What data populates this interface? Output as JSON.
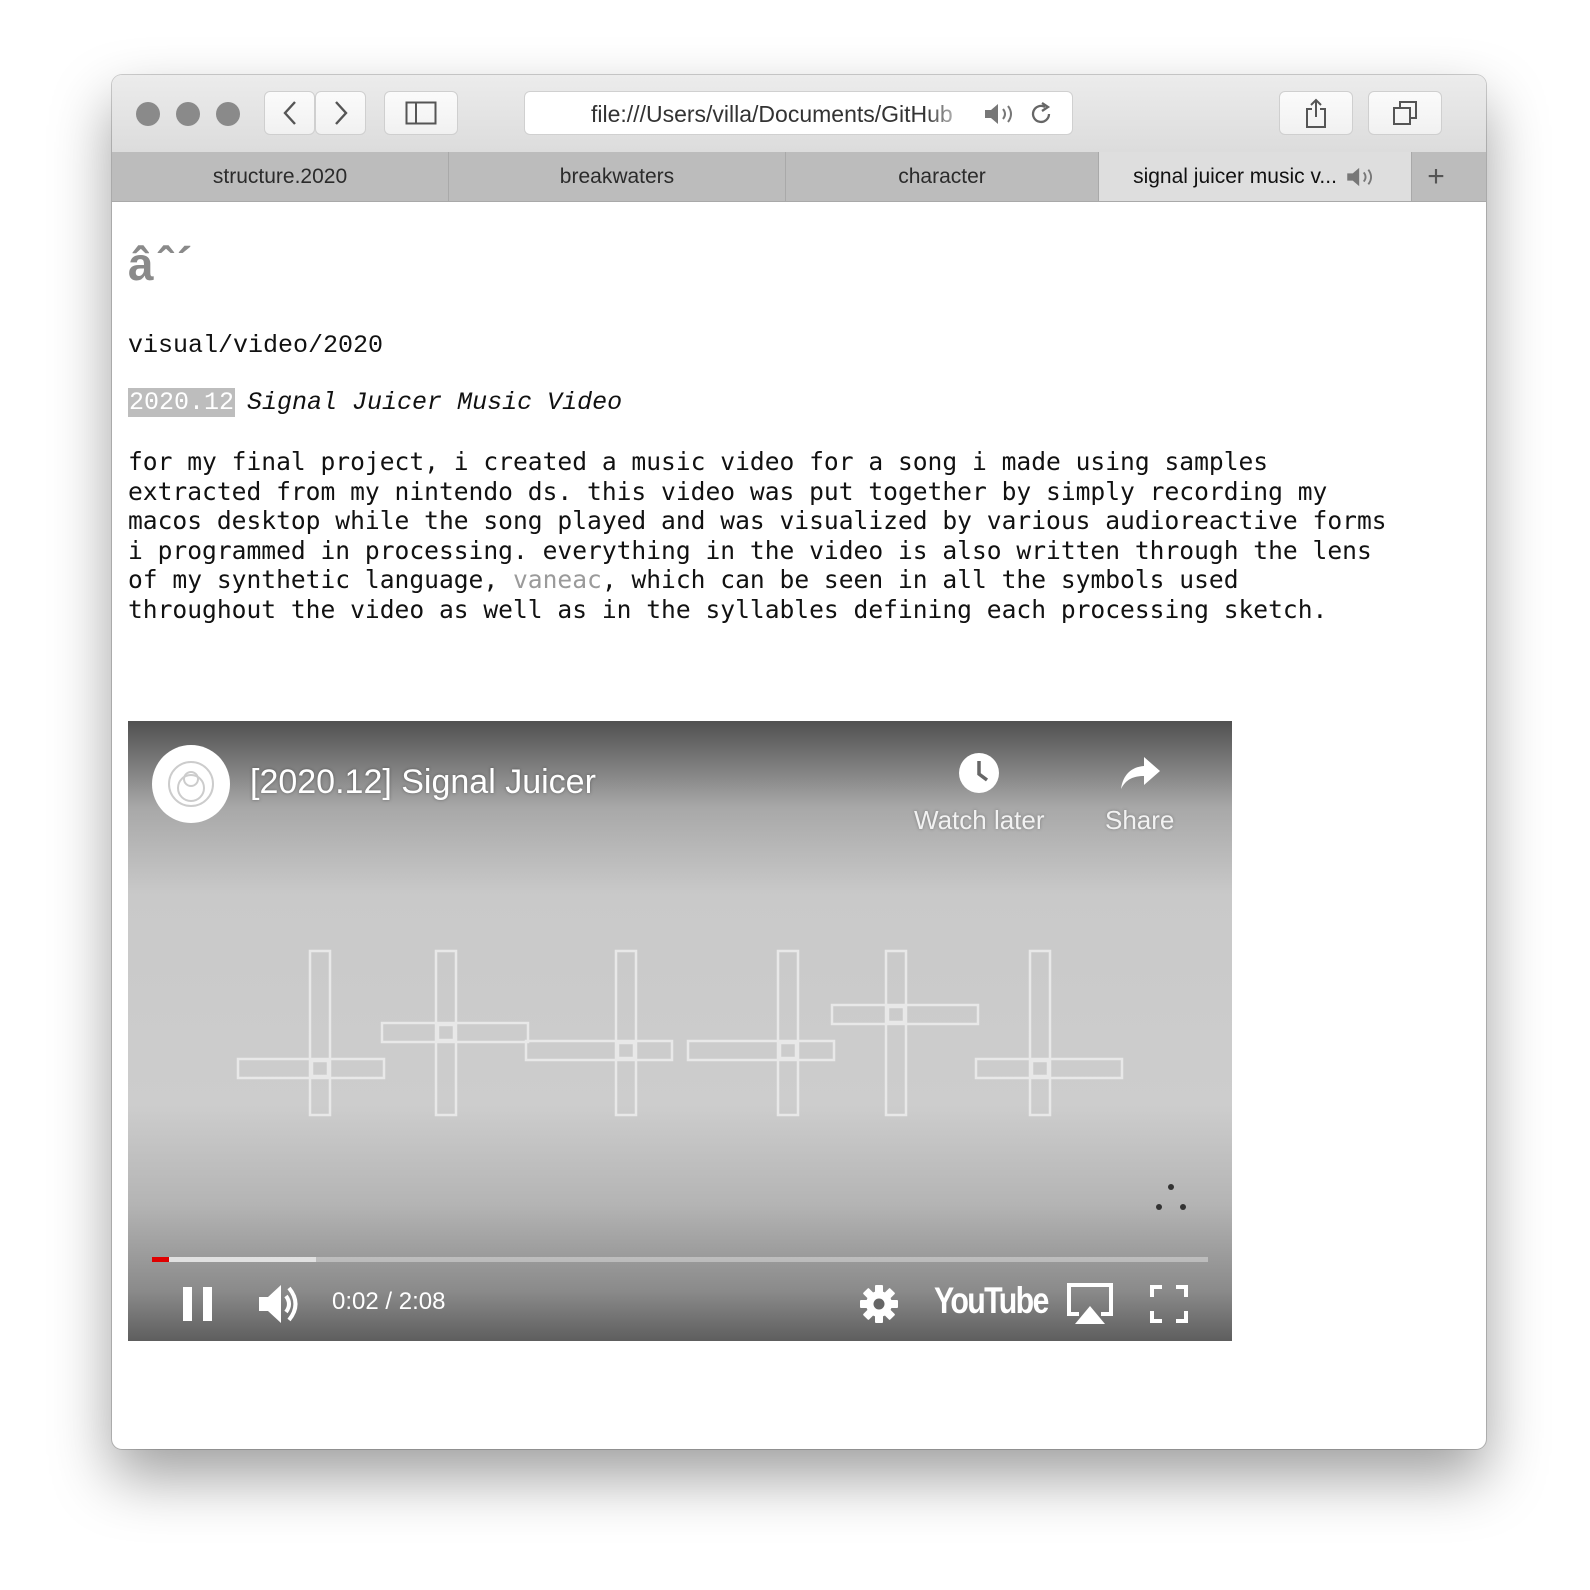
{
  "browser": {
    "url": "file:///Users/villa/Documents/GitHub",
    "tabs": [
      {
        "label": "structure.2020",
        "active": false
      },
      {
        "label": "breakwaters",
        "active": false
      },
      {
        "label": "character",
        "active": false
      },
      {
        "label": "signal juicer music v...",
        "active": true,
        "playing_audio": true
      }
    ],
    "new_tab_label": "+"
  },
  "page": {
    "logo_text": "âˆ´",
    "section": "visual/video/2020",
    "entry": {
      "date": "2020.12",
      "title": "Signal Juicer Music Video",
      "description_before_link": "for my final project, i created a music video for a song i made using samples\nextracted from my nintendo ds. this video was put together by simply recording my\nmacos desktop while the song played and was visualized by various audioreactive forms\ni programmed in processing. everything in the video is also written through the lens\nof my synthetic language, ",
      "link_text": "vaneac",
      "description_after_link": ", which can be seen in all the symbols used\nthroughout the video as well as in the syllables defining each processing sketch."
    }
  },
  "video": {
    "title": "[2020.12] Signal Juicer",
    "watch_later_label": "Watch later",
    "share_label": "Share",
    "time": "0:02 / 2:08",
    "current_seconds": 2,
    "duration_seconds": 128,
    "buffered_fraction": 0.155,
    "brand": "YouTube",
    "progress_color": "#e00000"
  },
  "icons": [
    "back-arrow-icon",
    "forward-arrow-icon",
    "sidebar-icon",
    "speaker-icon",
    "reload-icon",
    "share-icon",
    "tabs-icon",
    "clock-icon",
    "share-arrow-icon",
    "pause-icon",
    "volume-icon",
    "gear-icon",
    "airplay-icon",
    "fullscreen-icon"
  ]
}
